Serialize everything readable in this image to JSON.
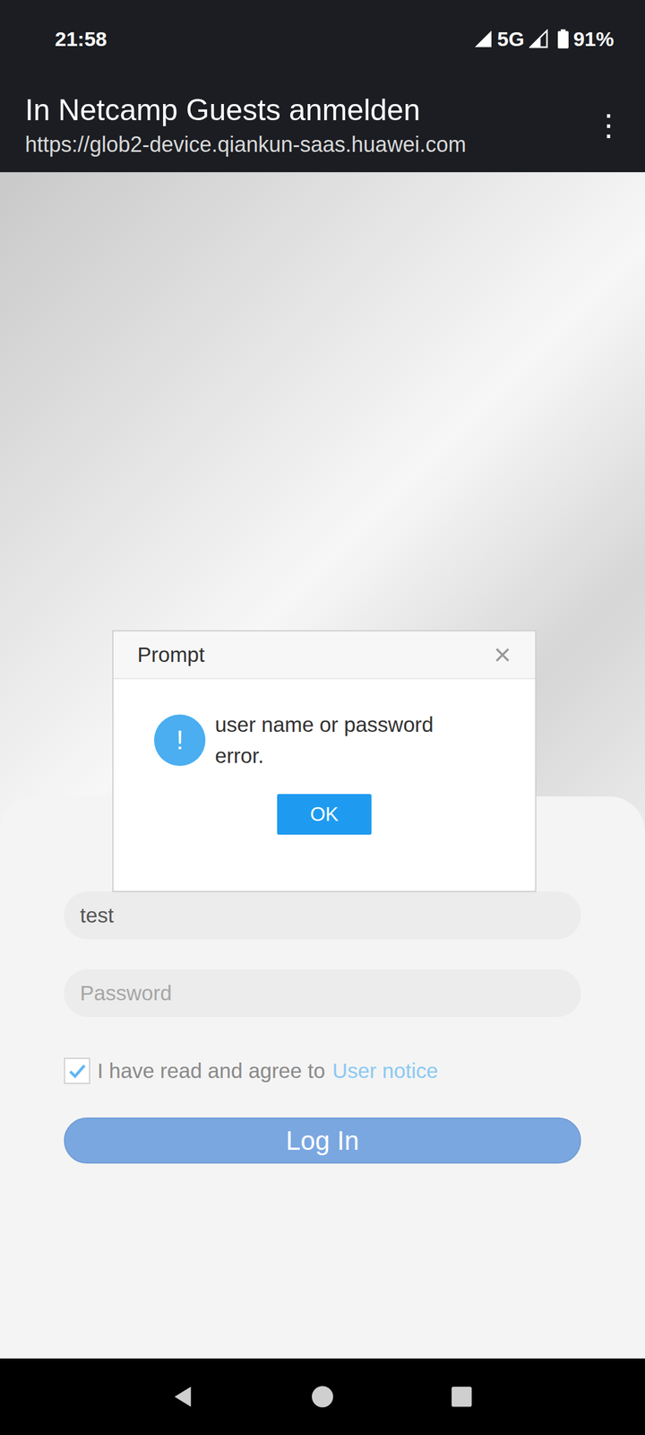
{
  "status_bar": {
    "time": "21:58",
    "network": "5G",
    "battery": "91%"
  },
  "header": {
    "title": "In Netcamp Guests anmelden",
    "url": "https://glob2-device.qiankun-saas.huawei.com",
    "menu": "⋮"
  },
  "login": {
    "username": "test",
    "password_placeholder": "Password",
    "agree_checked": true,
    "agree_text": "I have read and agree to",
    "agree_link": "User notice",
    "button": "Log In"
  },
  "dialog": {
    "title": "Prompt",
    "close": "×",
    "icon": "!",
    "message": "user name or password error.",
    "button": "OK"
  }
}
